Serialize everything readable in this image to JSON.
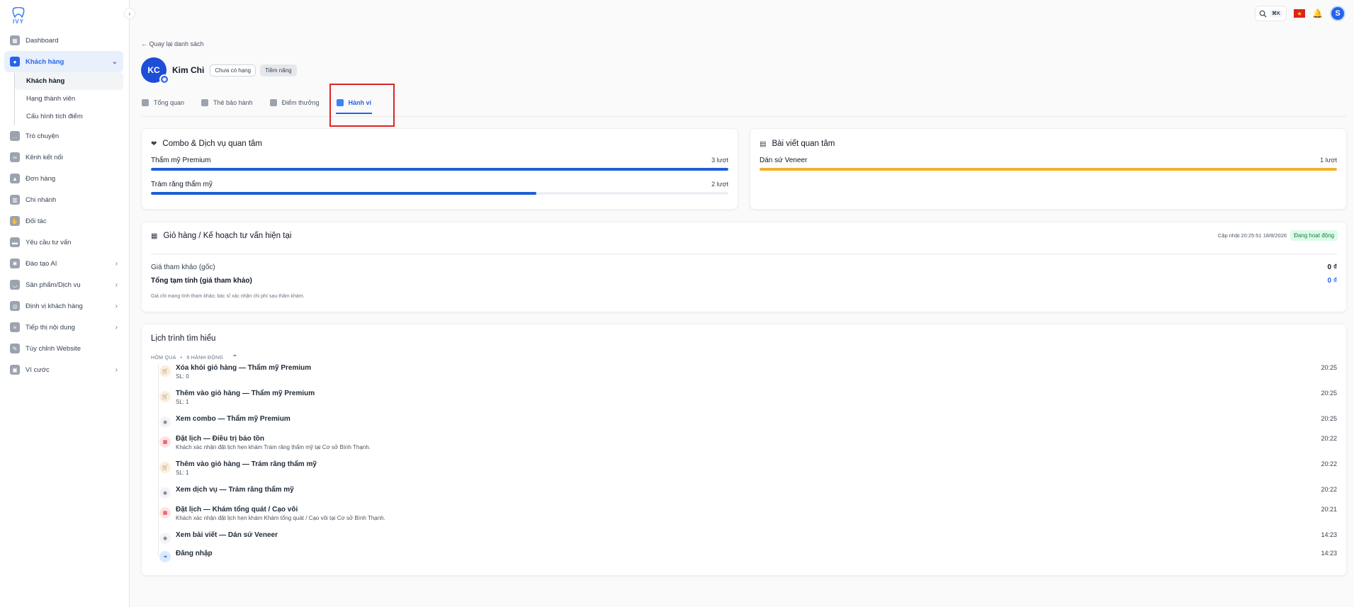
{
  "logo": {
    "text": "IVY"
  },
  "sidebar": {
    "items": [
      {
        "label": "Dashboard",
        "icon": "dashboard-icon"
      },
      {
        "label": "Khách hàng",
        "icon": "users-icon",
        "active": true
      },
      {
        "label": "Trò chuyện",
        "icon": "chat-icon"
      },
      {
        "label": "Kênh kết nối",
        "icon": "link-icon"
      },
      {
        "label": "Đơn hàng",
        "icon": "bag-icon"
      },
      {
        "label": "Chi nhánh",
        "icon": "building-icon"
      },
      {
        "label": "Đối tác",
        "icon": "handshake-icon"
      },
      {
        "label": "Yêu cầu tư vấn",
        "icon": "inbox-icon"
      },
      {
        "label": "Đào tạo AI",
        "icon": "ai-icon"
      },
      {
        "label": "Sản phẩm/Dịch vụ",
        "icon": "tooth-icon"
      },
      {
        "label": "Định vị khách hàng",
        "icon": "target-icon"
      },
      {
        "label": "Tiếp thị nội dung",
        "icon": "document-icon"
      },
      {
        "label": "Tùy chỉnh Website",
        "icon": "website-icon"
      },
      {
        "label": "Ví cước",
        "icon": "wallet-icon"
      }
    ],
    "subitems": [
      {
        "label": "Khách hàng",
        "active": true
      },
      {
        "label": "Hạng thành viên"
      },
      {
        "label": "Cấu hình tích điểm"
      }
    ]
  },
  "topbar": {
    "shortcut": "⌘K",
    "avatar_letter": "S"
  },
  "back_link": "← Quay lại danh sách",
  "profile": {
    "initials": "KC",
    "name": "Kim Chi",
    "badge_rank": "Chưa có hạng",
    "badge_status": "Tiềm năng"
  },
  "tabs": [
    {
      "label": "Tổng quan"
    },
    {
      "label": "Thẻ bảo hành"
    },
    {
      "label": "Điểm thưởng"
    },
    {
      "label": "Hành vi",
      "active": true
    }
  ],
  "combo": {
    "title": "Combo & Dịch vụ quan tâm",
    "items": [
      {
        "name": "Thẩm mỹ Premium",
        "count": "3 lượt",
        "fraction": 1.0,
        "color": "#1d5fd6"
      },
      {
        "name": "Trám răng thẩm mỹ",
        "count": "2 lượt",
        "fraction": 0.667,
        "color": "#1d5fd6"
      }
    ]
  },
  "articles": {
    "title": "Bài viết quan tâm",
    "items": [
      {
        "name": "Dán sứ Veneer",
        "count": "1 lượt",
        "fraction": 1.0,
        "color": "#f2b02b"
      }
    ]
  },
  "cart": {
    "title": "Giỏ hàng / Kế hoạch tư vấn hiện tại",
    "updated": "Cập nhật 20:25:51 18/8/2026",
    "status": "Đang hoạt động",
    "ref_label": "Giá tham khảo (gốc)",
    "ref_value": "0 ₫",
    "total_label": "Tổng tạm tính (giá tham khảo)",
    "total_value": "0 ₫",
    "note": "Giá chỉ mang tính tham khảo; bác sĩ xác nhận chi phí sau thăm khám."
  },
  "journey": {
    "title": "Lịch trình tìm hiểu",
    "day": "HÔM QUA",
    "count": "9 HÀNH ĐỘNG",
    "events": [
      {
        "title": "Xóa khỏi giỏ hàng — Thẩm mỹ Premium",
        "sub": "SL: 0",
        "time": "20:25",
        "kind": "cart"
      },
      {
        "title": "Thêm vào giỏ hàng — Thẩm mỹ Premium",
        "sub": "SL: 1",
        "time": "20:25",
        "kind": "cart"
      },
      {
        "title": "Xem combo — Thẩm mỹ Premium",
        "sub": "",
        "time": "20:25",
        "kind": "eye"
      },
      {
        "title": "Đặt lịch — Điều trị bảo tồn",
        "sub": "Khách xác nhận đặt lịch hẹn khám Trám răng thẩm mỹ tại Cơ sở Bình Thạnh.",
        "time": "20:22",
        "kind": "cal"
      },
      {
        "title": "Thêm vào giỏ hàng — Trám răng thẩm mỹ",
        "sub": "SL: 1",
        "time": "20:22",
        "kind": "cart"
      },
      {
        "title": "Xem dịch vụ — Trám răng thẩm mỹ",
        "sub": "",
        "time": "20:22",
        "kind": "eye"
      },
      {
        "title": "Đặt lịch — Khám tổng quát / Cạo vôi",
        "sub": "Khách xác nhận đặt lịch hẹn khám Khám tổng quát / Cạo vôi tại Cơ sở Bình Thạnh.",
        "time": "20:21",
        "kind": "cal"
      },
      {
        "title": "Xem bài viết — Dán sứ Veneer",
        "sub": "",
        "time": "14:23",
        "kind": "eye"
      },
      {
        "title": "Đăng nhập",
        "sub": "",
        "time": "14:23",
        "kind": "login"
      }
    ]
  }
}
